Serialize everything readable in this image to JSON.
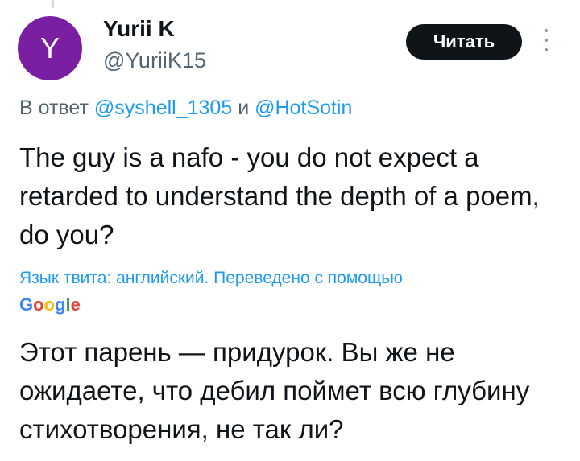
{
  "author": {
    "avatar_letter": "Y",
    "avatar_color": "#7b1fa2",
    "name": "Yurii K",
    "handle": "@YuriiK15"
  },
  "actions": {
    "read_button_label": "Читать",
    "more_icon": "more-vertical-icon"
  },
  "reply": {
    "prefix": "В ответ",
    "mention_1": "@syshell_1305",
    "conjunction": "и",
    "mention_2": "@HotSotin"
  },
  "tweet": {
    "text": "The guy is a nafo - you do not expect a retarded to understand the depth of a poem, do you?"
  },
  "translation": {
    "note": "Язык твита: английский. Переведено с помощью",
    "provider_letters": [
      "G",
      "o",
      "o",
      "g",
      "l",
      "e"
    ],
    "provider_colors": [
      "#4285F4",
      "#EA4335",
      "#FBBC05",
      "#4285F4",
      "#34A853",
      "#EA4335"
    ],
    "text": "Этот парень — придурок. Вы же не ожидаете, что дебил поймет всю глубину стихотворения, не так ли?"
  },
  "colors": {
    "mention": "#1d9bf0",
    "secondary_text": "#536471",
    "button_bg": "#0f1419"
  }
}
